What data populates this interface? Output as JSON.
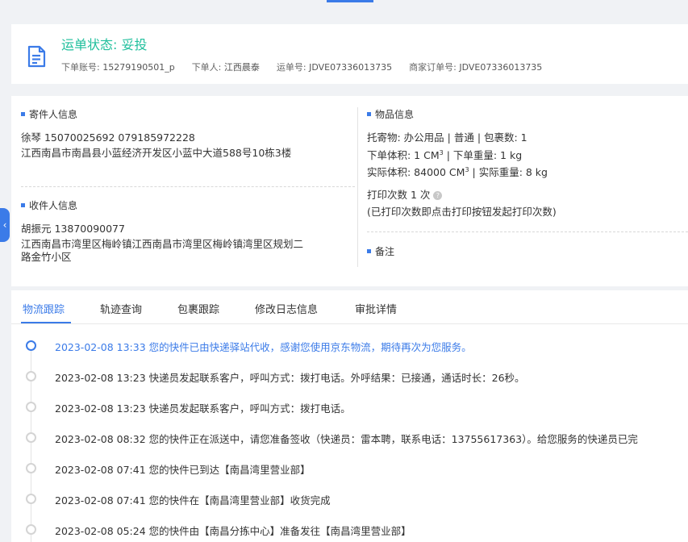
{
  "header": {
    "status": "运单状态: 妥投",
    "order_account_label": "下单账号:",
    "order_account": "15279190501_p",
    "orderer_label": "下单人:",
    "orderer": "江西晨泰",
    "waybill_label": "运单号:",
    "waybill": "JDVE07336013735",
    "merchant_order_label": "商家订单号:",
    "merchant_order": "JDVE07336013735"
  },
  "sender": {
    "title": "寄件人信息",
    "name_phone": "徐琴   15070025692   079185972228",
    "address": "江西南昌市南昌县小蓝经济开发区小蓝中大道588号10栋3楼"
  },
  "receiver": {
    "title": "收件人信息",
    "name_phone": "胡振元   13870090077",
    "address_line1": "江西南昌市湾里区梅岭镇江西南昌市湾里区梅岭镇湾里区规划二",
    "address_line2": "路金竹小区"
  },
  "goods": {
    "title": "物品信息",
    "line1": "托寄物:  办公用品 | 普通  | 包裹数:  1",
    "order_volume_label": "下单体积:   1 CM",
    "order_weight": " | 下单重量:   1 kg",
    "actual_volume_label": "实际体积:   84000 CM",
    "actual_weight": " | 实际重量:   8 kg",
    "sup": "3",
    "print_count": "打印次数   1 次",
    "print_hint": "(已打印次数即点击打印按钮发起打印次数)"
  },
  "remark": {
    "title": "备注"
  },
  "tabs": [
    "物流跟踪",
    "轨迹查询",
    "包裹跟踪",
    "修改日志信息",
    "审批详情"
  ],
  "timeline": [
    "2023-02-08 13:33 您的快件已由快递驿站代收，感谢您使用京东物流，期待再次为您服务。",
    "2023-02-08 13:23 快递员发起联系客户，呼叫方式：拨打电话。外呼结果：已接通，通话时长：26秒。",
    "2023-02-08 13:23 快递员发起联系客户，呼叫方式：拨打电话。",
    "2023-02-08 08:32 您的快件正在派送中，请您准备签收（快递员：雷本聘，联系电话：13755617363）。给您服务的快递员已完",
    "2023-02-08 07:41 您的快件已到达【南昌湾里营业部】",
    "2023-02-08 07:41 您的快件在【南昌湾里营业部】收货完成",
    "2023-02-08 05:24 您的快件由【南昌分拣中心】准备发往【南昌湾里营业部】"
  ],
  "colors": {
    "accent": "#3b7be8",
    "status": "#1fbf9c"
  }
}
